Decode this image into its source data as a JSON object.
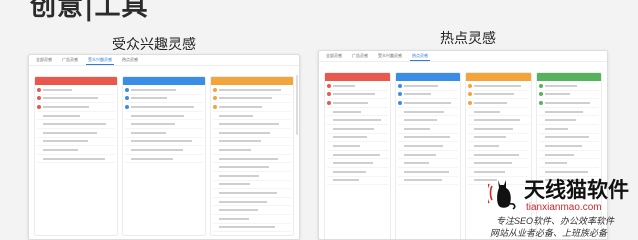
{
  "slide": {
    "title": "创意|工具"
  },
  "captions": {
    "left": "受众兴趣灵感",
    "right": "热点灵感"
  },
  "left_panel": {
    "tabs": [
      "全部灵感",
      "广告灵感",
      "受众兴趣灵感",
      "热点灵感"
    ],
    "active_tab": 2,
    "columns": [
      {
        "color": "red",
        "rows": 9
      },
      {
        "color": "blue",
        "rows": 9
      },
      {
        "color": "orange",
        "rows": 18
      }
    ]
  },
  "right_panel": {
    "tabs": [
      "全部灵感",
      "广告灵感",
      "受众兴趣灵感",
      "热点灵感"
    ],
    "active_tab": 3,
    "columns": [
      {
        "color": "red",
        "rows": 12
      },
      {
        "color": "blue",
        "rows": 12
      },
      {
        "color": "orange",
        "rows": 12
      },
      {
        "color": "green",
        "rows": 12
      }
    ]
  },
  "watermark": {
    "brand": "天线猫软件",
    "domain": "tianxianmao.com",
    "slogan_line1": "专注SEO软件、办公效率软件",
    "slogan_line2": "网站从业者必备、上班族必备"
  },
  "colors": {
    "red": "#e8584d",
    "blue": "#3a8ee6",
    "orange": "#f3a43a",
    "green": "#57b25e",
    "brand_red": "#d0262b"
  }
}
